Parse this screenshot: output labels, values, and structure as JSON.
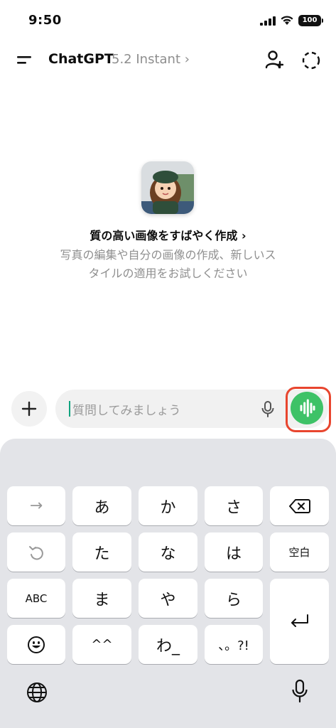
{
  "status_bar": {
    "time": "9:50",
    "battery": "100"
  },
  "header": {
    "title": "ChatGPT",
    "model": "5.2 Instant ›"
  },
  "suggestion": {
    "title": "質の高い画像をすばやく作成 ›",
    "description_line1": "写真の編集や自分の画像の作成、新しいス",
    "description_line2": "タイルの適用をお試しください"
  },
  "composer": {
    "placeholder": "質問してみましょう"
  },
  "keyboard": {
    "row1": [
      "→",
      "あ",
      "か",
      "さ"
    ],
    "row2": [
      "",
      "た",
      "な",
      "は",
      "空白"
    ],
    "row3": [
      "ABC",
      "ま",
      "や",
      "ら"
    ],
    "row4": [
      "",
      "^^",
      "わ_",
      "、。?!"
    ]
  },
  "colors": {
    "accent_green": "#3ec267",
    "highlight_red": "#e8452e"
  }
}
